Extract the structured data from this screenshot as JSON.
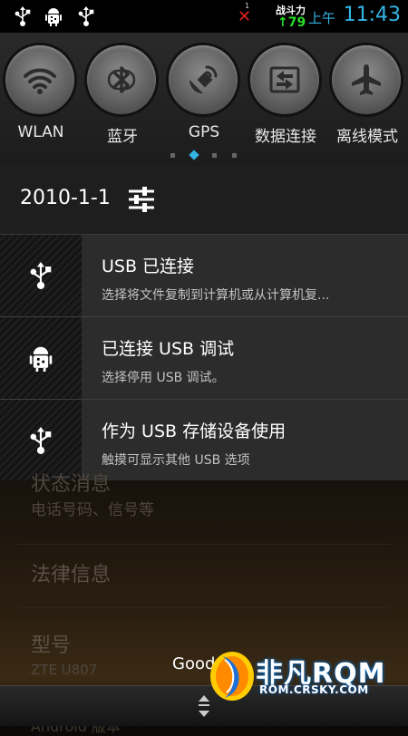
{
  "status_bar": {
    "icons": [
      "usb-icon",
      "android-debug-icon",
      "usb-icon"
    ],
    "sim_slot": "1",
    "carrier": "战斗力",
    "signal": "↑79",
    "ampm": "上午",
    "time": "11:43",
    "accent_color": "#33b5e5"
  },
  "toggles": [
    {
      "icon": "wifi-icon",
      "label": "WLAN"
    },
    {
      "icon": "bluetooth-icon",
      "label": "蓝牙"
    },
    {
      "icon": "gps-icon",
      "label": "GPS"
    },
    {
      "icon": "data-connection-icon",
      "label": "数据连接"
    },
    {
      "icon": "airplane-icon",
      "label": "离线模式"
    }
  ],
  "pager": {
    "pages": 5,
    "active_index": 1
  },
  "date_row": {
    "date": "2010-1-1",
    "settings_icon": "sliders-icon"
  },
  "notifications": [
    {
      "icon": "usb-icon",
      "title": "USB 已连接",
      "subtitle": "选择将文件复制到计算机或从计算机复..."
    },
    {
      "icon": "android-debug-icon",
      "title": "已连接 USB 调试",
      "subtitle": "选择停用 USB 调试。"
    },
    {
      "icon": "usb-icon",
      "title": "作为 USB 存储设备使用",
      "subtitle": "触摸可显示其他 USB 选项"
    }
  ],
  "background": {
    "status_title": "状态消息",
    "status_sub": "电话号码、信号等",
    "legal": "法律信息",
    "model_title": "型号",
    "model_value": "ZTE U807",
    "android_version": "Android 版本",
    "good_text": "Good"
  },
  "watermark": {
    "main": "非凡RQM",
    "url": "ROM.CRSKY.COM"
  }
}
